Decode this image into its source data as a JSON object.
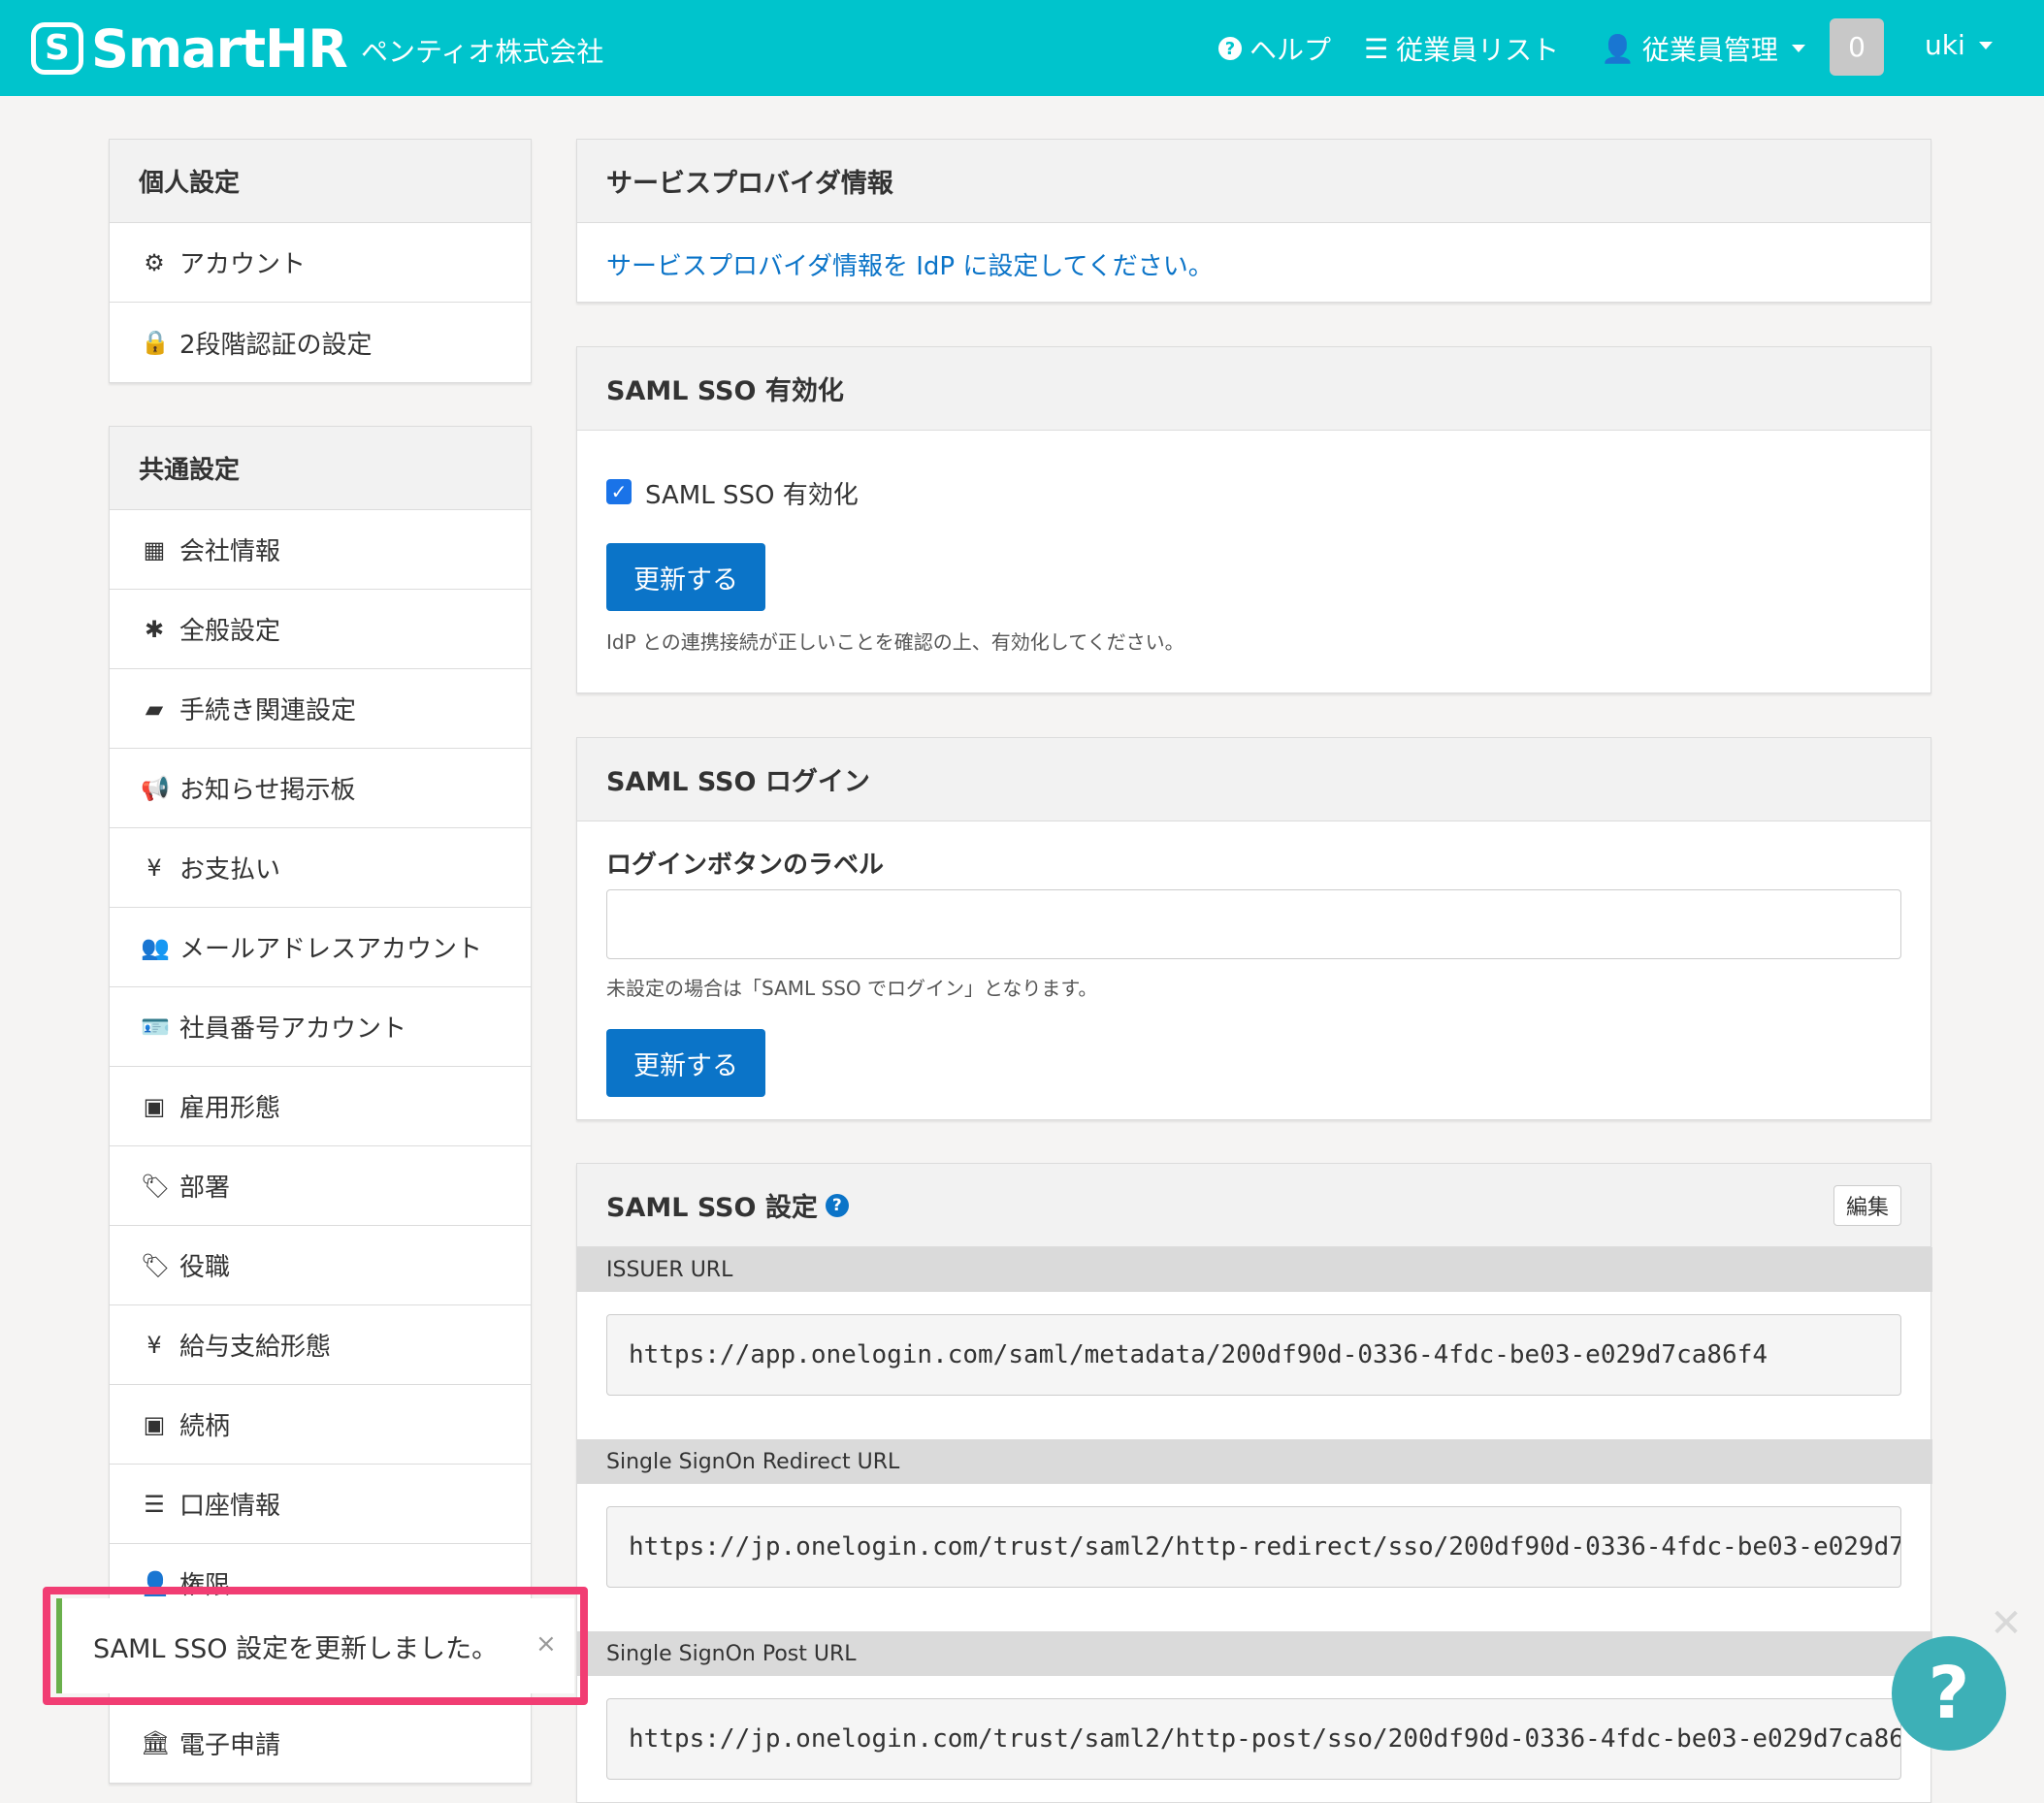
{
  "header": {
    "logo_mark": "S",
    "logo_text": "SmartHR",
    "company": "ペンティオ株式会社",
    "help": "ヘルプ",
    "employee_list": "従業員リスト",
    "employee_manage": "従業員管理",
    "notification_count": "0",
    "user": "uki"
  },
  "sidebar": {
    "personal": {
      "title": "個人設定",
      "items": [
        {
          "icon": "gear-icon",
          "glyph": "⚙",
          "label": "アカウント"
        },
        {
          "icon": "lock-icon",
          "glyph": "🔒",
          "label": "2段階認証の設定"
        }
      ]
    },
    "common": {
      "title": "共通設定",
      "items": [
        {
          "icon": "building-icon",
          "glyph": "▦",
          "label": "会社情報"
        },
        {
          "icon": "asterisk-icon",
          "glyph": "✱",
          "label": "全般設定"
        },
        {
          "icon": "book-icon",
          "glyph": "▰",
          "label": "手続き関連設定"
        },
        {
          "icon": "bullhorn-icon",
          "glyph": "📢",
          "label": "お知らせ掲示板"
        },
        {
          "icon": "yen-icon",
          "glyph": "¥",
          "label": "お支払い"
        },
        {
          "icon": "users-icon",
          "glyph": "👥",
          "label": "メールアドレスアカウント"
        },
        {
          "icon": "id-card-icon",
          "glyph": "🪪",
          "label": "社員番号アカウント"
        },
        {
          "icon": "badge-icon",
          "glyph": "▣",
          "label": "雇用形態"
        },
        {
          "icon": "tags-icon",
          "glyph": "🏷",
          "label": "部署"
        },
        {
          "icon": "tag-icon",
          "glyph": "🏷",
          "label": "役職"
        },
        {
          "icon": "yen-circle-icon",
          "glyph": "¥",
          "label": "給与支給形態"
        },
        {
          "icon": "contact-icon",
          "glyph": "▣",
          "label": "続柄"
        },
        {
          "icon": "list-alt-icon",
          "glyph": "☰",
          "label": "口座情報"
        },
        {
          "icon": "user-icon",
          "glyph": "👤",
          "label": "権限"
        },
        {
          "icon": "hidden-item",
          "glyph": "",
          "label": ""
        },
        {
          "icon": "bank-icon",
          "glyph": "🏛",
          "label": "電子申請"
        }
      ]
    }
  },
  "main": {
    "sp_info": {
      "title": "サービスプロバイダ情報",
      "link": "サービスプロバイダ情報を IdP に設定してください。"
    },
    "sso_enable": {
      "title": "SAML SSO 有効化",
      "checkbox_label": "SAML SSO 有効化",
      "checked": true,
      "button": "更新する",
      "hint": "IdP との連携接続が正しいことを確認の上、有効化してください。"
    },
    "sso_login": {
      "title": "SAML SSO ログイン",
      "field_label": "ログインボタンのラベル",
      "field_value": "",
      "hint": "未設定の場合は「SAML SSO でログイン」となります。",
      "button": "更新する"
    },
    "sso_settings": {
      "title": "SAML SSO 設定",
      "edit": "編集",
      "issuer_label": "ISSUER URL",
      "issuer_value": "https://app.onelogin.com/saml/metadata/200df90d-0336-4fdc-be03-e029d7ca86f4",
      "redirect_label": "Single SignOn Redirect URL",
      "redirect_value": "https://jp.onelogin.com/trust/saml2/http-redirect/sso/200df90d-0336-4fdc-be03-e029d7",
      "post_label": "Single SignOn Post URL",
      "post_value": "https://jp.onelogin.com/trust/saml2/http-post/sso/200df90d-0336-4fdc-be03-e029d7ca86"
    }
  },
  "toast": {
    "message": "SAML SSO 設定を更新しました。",
    "close": "×"
  },
  "float_help": "?",
  "colors": {
    "brand": "#00c4cc",
    "primary": "#0b74c8",
    "highlight": "#f13d73",
    "success": "#6ab04c"
  }
}
